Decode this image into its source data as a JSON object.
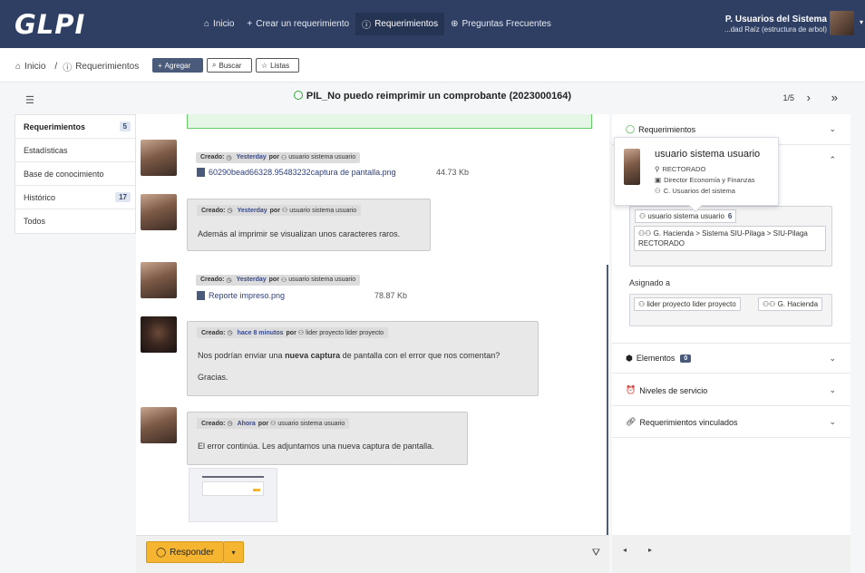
{
  "app": {
    "logo": "GLPI"
  },
  "nav": {
    "items": [
      {
        "label": "Inicio",
        "icon": "home-icon",
        "glyph": "⌂",
        "active": false
      },
      {
        "label": "Crear un requerimiento",
        "icon": "plus-icon",
        "glyph": "+",
        "active": false
      },
      {
        "label": "Requerimientos",
        "icon": "alert-circle-icon",
        "glyph": "ⓘ",
        "active": true
      },
      {
        "label": "Preguntas Frecuentes",
        "icon": "lifebuoy-icon",
        "glyph": "⊕",
        "active": false
      }
    ]
  },
  "user": {
    "name": "P. Usuarios del Sistema",
    "entity": "...dad Raíz (estructura de arbol)"
  },
  "breadcrumb": {
    "home": "Inicio",
    "sep": "/",
    "current": "Requerimientos"
  },
  "actions": {
    "add": "Agregar",
    "search": "Buscar",
    "lists": "Listas"
  },
  "ticket": {
    "title": "PIL_No puedo reimprimir un comprobante (2023000164)",
    "pager": "1/5"
  },
  "sidemenu": [
    {
      "label": "Requerimientos",
      "badge": "5",
      "active": true
    },
    {
      "label": "Estadísticas",
      "badge": ""
    },
    {
      "label": "Base de conocimiento",
      "badge": ""
    },
    {
      "label": "Histórico",
      "badge": "17"
    },
    {
      "label": "Todos",
      "badge": ""
    }
  ],
  "timeline": {
    "created_label": "Creado:",
    "by_label": "por",
    "entries": [
      {
        "when": "Yesterday",
        "author": "usuario sistema usuario",
        "doc": "60290bead66328.95483232captura de pantalla.png",
        "size": "44.73 Kb"
      },
      {
        "when": "Yesterday",
        "author": "usuario sistema usuario",
        "text": "Además al imprimir se visualizan unos caracteres raros."
      },
      {
        "when": "Yesterday",
        "author": "usuario sistema usuario",
        "doc": "Reporte impreso.png",
        "size": "78.87 Kb"
      },
      {
        "when": "hace 8 minutos",
        "author": "lider proyecto lider proyecto",
        "text_pre": "Nos podrían enviar una ",
        "text_bold": "nueva captura",
        "text_post": " de pantalla con el error que nos comentan?",
        "text2": "Gracias."
      },
      {
        "when": "Ahora",
        "author": "usuario sistema usuario",
        "text": "El error continúa. Les adjuntamos una nueva captura de pantalla."
      }
    ]
  },
  "reply": {
    "label": "Responder"
  },
  "right": {
    "requerimientos": "Requerimientos",
    "requester_chips": [
      {
        "label": "usuario sistema usuario",
        "count": "6"
      },
      {
        "label": "G. Hacienda > Sistema SIU-Pilaga > SIU-Pilaga",
        "sub": "RECTORADO"
      }
    ],
    "assigned_label": "Asignado a",
    "assigned_chips": [
      {
        "label": "lider proyecto lider proyecto"
      },
      {
        "label": "G. Hacienda"
      }
    ],
    "elements": {
      "label": "Elementos",
      "badge": "0"
    },
    "sla": "Niveles de servicio",
    "linked": "Requerimientos vinculados"
  },
  "tooltip": {
    "name": "usuario sistema usuario",
    "location": "RECTORADO",
    "title": "Director Economía y Finanzas",
    "category": "C. Usuarios del sistema"
  }
}
